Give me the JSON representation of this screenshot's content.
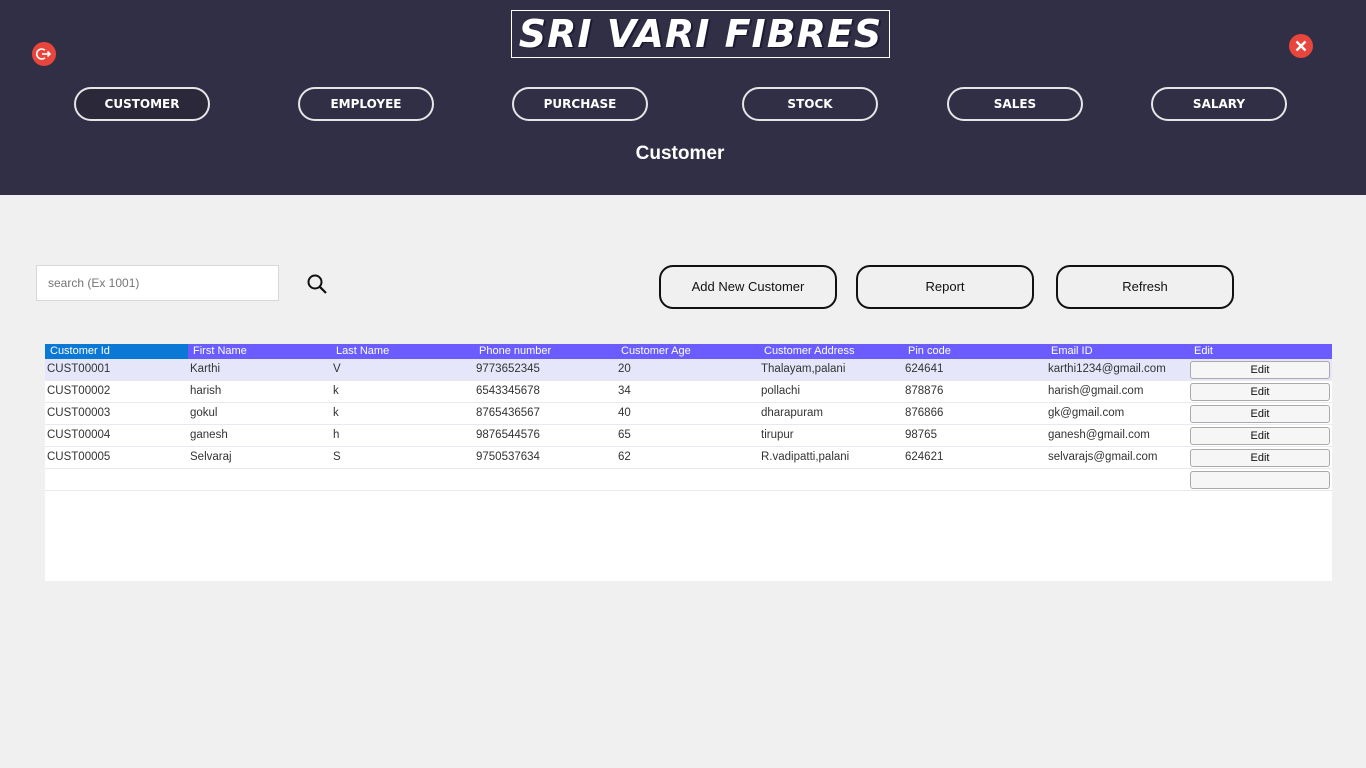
{
  "app": {
    "logo_text": "SRI VARI FIBRES",
    "page_title": "Customer"
  },
  "nav": [
    {
      "label": "CUSTOMER",
      "active": true
    },
    {
      "label": "EMPLOYEE",
      "active": false
    },
    {
      "label": "PURCHASE",
      "active": false
    },
    {
      "label": "STOCK",
      "active": false
    },
    {
      "label": "SALES",
      "active": false
    },
    {
      "label": "SALARY",
      "active": false
    }
  ],
  "icons": {
    "logout": "logout-icon",
    "close": "close-icon",
    "search": "search-icon"
  },
  "search": {
    "placeholder": "search (Ex 1001)",
    "value": ""
  },
  "actions": {
    "add_label": "Add New Customer",
    "report_label": "Report",
    "refresh_label": "Refresh"
  },
  "table": {
    "columns": [
      "Customer Id",
      "First Name",
      "Last Name",
      "Phone number",
      "Customer Age",
      "Customer Address",
      "Pin code",
      "Email ID",
      "Edit"
    ],
    "rows": [
      [
        "CUST00001",
        "Karthi",
        "V",
        "9773652345",
        "20",
        "Thalayam,palani",
        "624641",
        "karthi1234@gmail.com",
        "Edit"
      ],
      [
        "CUST00002",
        "harish",
        "k",
        "6543345678",
        "34",
        "pollachi",
        "878876",
        "harish@gmail.com",
        "Edit"
      ],
      [
        "CUST00003",
        "gokul",
        "k",
        "8765436567",
        "40",
        "dharapuram",
        "876866",
        "gk@gmail.com",
        "Edit"
      ],
      [
        "CUST00004",
        "ganesh",
        "h",
        "9876544576",
        "65",
        "tirupur",
        "98765",
        "ganesh@gmail.com",
        "Edit"
      ],
      [
        "CUST00005",
        "Selvaraj",
        "S",
        "9750537634",
        "62",
        "R.vadipatti,palani",
        "624621",
        "selvarajs@gmail.com",
        "Edit"
      ]
    ],
    "new_row_edit": ""
  },
  "colors": {
    "header_bg": "#312f45",
    "grid_header": "#6a5cff",
    "grid_header_first": "#0a78d4",
    "close_red": "#e8453c"
  }
}
